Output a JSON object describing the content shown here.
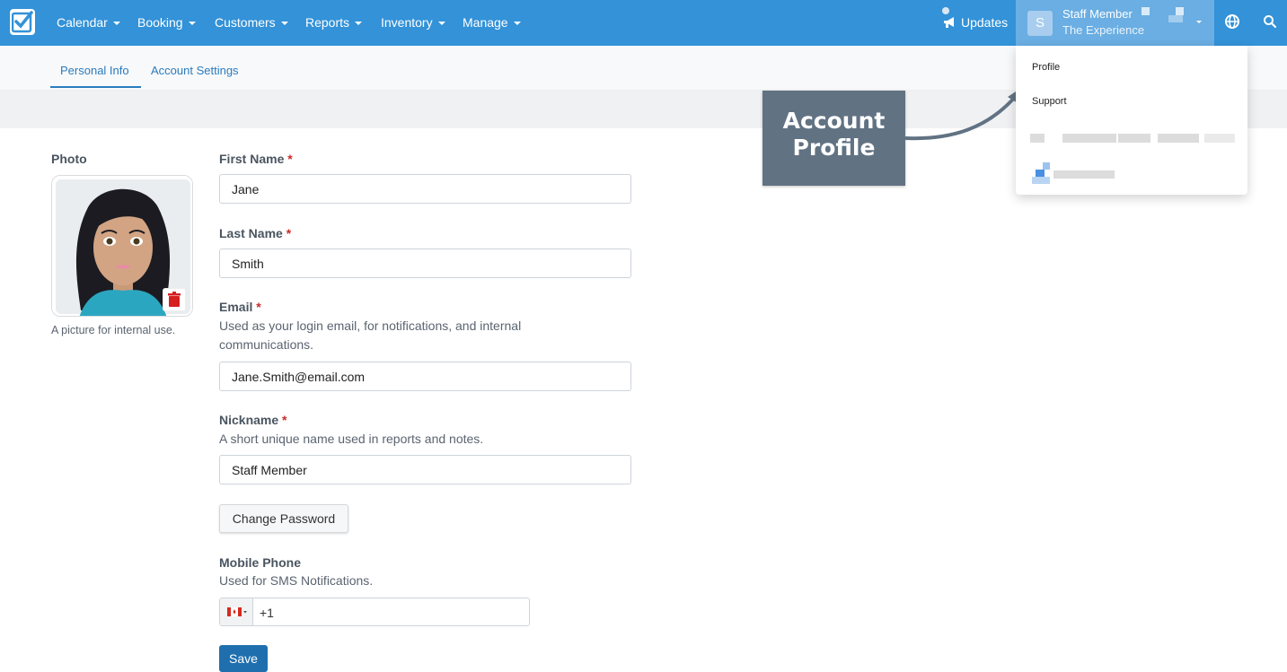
{
  "nav": {
    "items": [
      "Calendar",
      "Booking",
      "Customers",
      "Reports",
      "Inventory",
      "Manage"
    ],
    "updates_label": "Updates",
    "user": {
      "avatar_letter": "S",
      "name": "Staff Member",
      "org": "The Experience"
    }
  },
  "tabs": {
    "personal_info": "Personal Info",
    "account_settings": "Account Settings"
  },
  "form": {
    "photo_label": "Photo",
    "photo_help": "A picture for internal use.",
    "first_name_label": "First Name",
    "first_name_value": "Jane",
    "last_name_label": "Last Name",
    "last_name_value": "Smith",
    "email_label": "Email",
    "email_help": "Used as your login email, for notifications, and internal communications.",
    "email_value": "Jane.Smith@email.com",
    "nickname_label": "Nickname",
    "nickname_help": "A short unique name used in reports and notes.",
    "nickname_value": "Staff Member",
    "change_password": "Change Password",
    "mobile_label": "Mobile Phone",
    "mobile_help": "Used for SMS Notifications.",
    "phone_prefix": "+1",
    "save": "Save",
    "required_mark": "*"
  },
  "dropdown": {
    "profile": "Profile",
    "support": "Support"
  },
  "callout": {
    "line1": "Account",
    "line2": "Profile"
  },
  "colors": {
    "nav_bg": "#3392d8",
    "link": "#2a7bbd",
    "save": "#1f6fae",
    "callout": "#617283"
  }
}
